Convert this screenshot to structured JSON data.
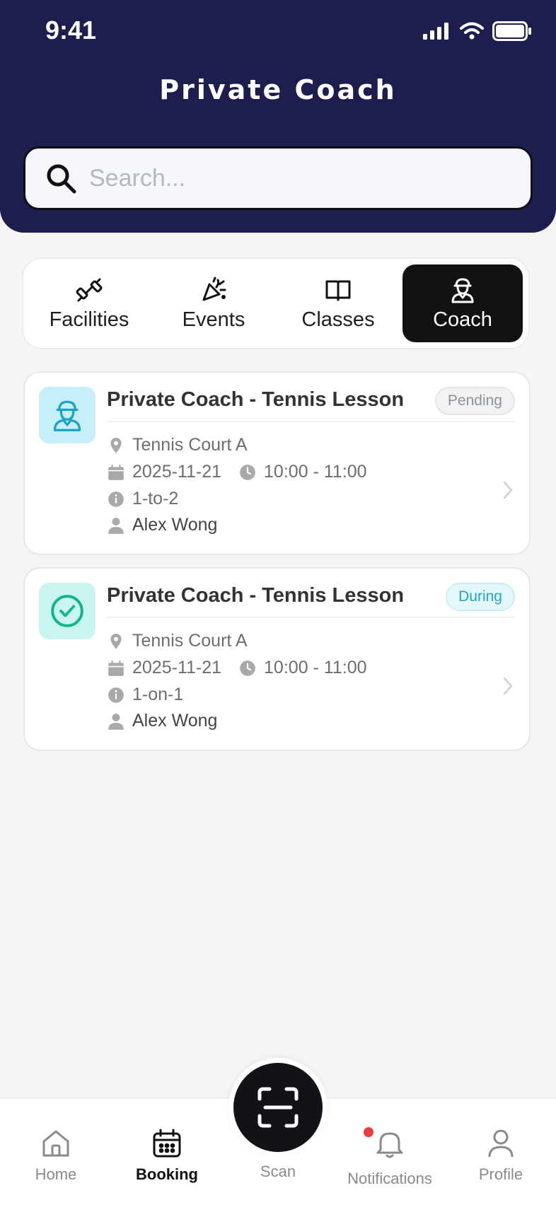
{
  "status": {
    "time": "9:41"
  },
  "header": {
    "title": "Private Coach"
  },
  "search": {
    "placeholder": "Search..."
  },
  "tabs": [
    {
      "label": "Facilities",
      "icon": "dumbbell-icon",
      "active": false
    },
    {
      "label": "Events",
      "icon": "party-popper-icon",
      "active": false
    },
    {
      "label": "Classes",
      "icon": "book-icon",
      "active": false
    },
    {
      "label": "Coach",
      "icon": "coach-icon",
      "active": true
    }
  ],
  "bookings": [
    {
      "title": "Private Coach - Tennis Lesson",
      "status": "Pending",
      "location": "Tennis Court A",
      "date": "2025-11-21",
      "time": "10:00 - 11:00",
      "type": "1-to-2",
      "coach": "Alex Wong",
      "icon": "coach-icon"
    },
    {
      "title": "Private Coach - Tennis Lesson",
      "status": "During",
      "location": "Tennis Court A",
      "date": "2025-11-21",
      "time": "10:00 - 11:00",
      "type": "1-on-1",
      "coach": "Alex Wong",
      "icon": "check-circle-icon"
    }
  ],
  "nav": {
    "home": "Home",
    "booking": "Booking",
    "scan": "Scan",
    "notifications": "Notifications",
    "profile": "Profile"
  },
  "colors": {
    "header_bg": "#1d1e4e",
    "active_tab": "#111214",
    "pending_badge": "#8f9399",
    "during_badge": "#21a4c0",
    "notification_dot": "#ef3b3b"
  }
}
